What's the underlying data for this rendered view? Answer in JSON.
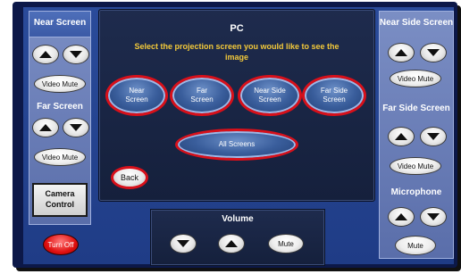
{
  "left_panel": {
    "near_screen_label": "Near Screen",
    "near_video_mute": "Video Mute",
    "far_screen_label": "Far Screen",
    "far_video_mute": "Video Mute",
    "camera_control_line1": "Camera",
    "camera_control_line2": "Control",
    "turn_off": "Turn Off"
  },
  "center": {
    "title": "PC",
    "instruction": "Select the projection screen you would like to see the image",
    "screens": [
      {
        "line1": "Near",
        "line2": "Screen"
      },
      {
        "line1": "Far",
        "line2": "Screen"
      },
      {
        "line1": "Near Side",
        "line2": "Screen"
      },
      {
        "line1": "Far Side",
        "line2": "Screen"
      }
    ],
    "all_screens": "All Screens",
    "back": "Back"
  },
  "volume": {
    "label": "Volume",
    "mute": "Mute"
  },
  "right_panel": {
    "near_side_label": "Near Side Screen",
    "near_side_video_mute": "Video Mute",
    "far_side_label": "Far Side Screen",
    "far_side_video_mute": "Video Mute",
    "microphone_label": "Microphone",
    "mic_mute": "Mute"
  },
  "colors": {
    "highlight_red": "#d8101a",
    "instruction_yellow": "#f3c93a",
    "panel_navy": "#15203c"
  }
}
